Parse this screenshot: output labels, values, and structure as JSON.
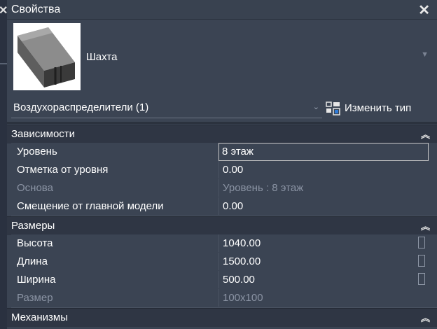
{
  "window": {
    "title": "Свойства",
    "close_icon": "close-icon"
  },
  "type_selector": {
    "thumbnail_icon": "duct-shaft-thumbnail",
    "name": "Шахта",
    "dropdown_icon": "dropdown-arrow-icon"
  },
  "instance_selector": {
    "label": "Воздухораспределители (1)",
    "edit_type_label": "Изменить тип"
  },
  "groups": {
    "constraints": {
      "title": "Зависимости",
      "rows": [
        {
          "name": "Уровень",
          "value": "8 этаж",
          "editable": true
        },
        {
          "name": "Отметка от уровня",
          "value": "0.00",
          "editable": true
        },
        {
          "name": "Основа",
          "value": "Уровень : 8 этаж",
          "editable": false
        },
        {
          "name": "Смещение от главной модели",
          "value": "0.00",
          "editable": true
        }
      ]
    },
    "dimensions": {
      "title": "Размеры",
      "rows": [
        {
          "name": "Высота",
          "value": "1040.00",
          "editable": true
        },
        {
          "name": "Длина",
          "value": "1500.00",
          "editable": true
        },
        {
          "name": "Ширина",
          "value": "500.00",
          "editable": true
        },
        {
          "name": "Размер",
          "value": "100x100",
          "editable": false
        }
      ]
    },
    "mechanisms": {
      "title": "Механизмы"
    }
  },
  "colors": {
    "panel_bg": "#3b4453",
    "group_bg": "#2f3644",
    "disabled_text": "#8a93a3"
  }
}
